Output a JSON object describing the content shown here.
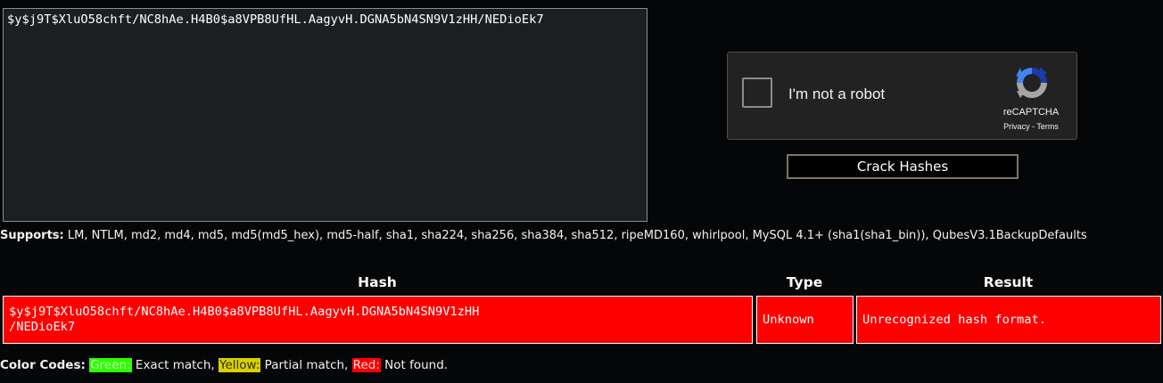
{
  "hash_input": {
    "value": "$y$j9T$XluO58chft/NC8hAe.H4B0$a8VPB8UfHL.AagyvH.DGNA5bN4SN9V1zHH/NEDioEk7"
  },
  "recaptcha": {
    "checkbox_label": "I'm not a robot",
    "brand": "reCAPTCHA",
    "privacy_label": "Privacy",
    "separator": " - ",
    "terms_label": "Terms",
    "checked": false,
    "logo_icon": "recaptcha-logo-icon"
  },
  "crack_button": {
    "label": "Crack Hashes"
  },
  "supports": {
    "label": "Supports:",
    "list": " LM, NTLM, md2, md4, md5, md5(md5_hex), md5-half, sha1, sha224, sha256, sha384, sha512, ripeMD160, whirlpool, MySQL 4.1+ (sha1(sha1_bin)), QubesV3.1BackupDefaults"
  },
  "results": {
    "columns": [
      "Hash",
      "Type",
      "Result"
    ],
    "rows": [
      {
        "hash_line1": "$y$j9T$XluO58chft/NC8hAe.H4B0$a8VPB8UfHL.AagyvH.DGNA5bN4SN9V1zHH",
        "hash_line2": "/NEDioEk7",
        "type": "Unknown",
        "result": "Unrecognized hash format.",
        "status_color": "#ff0000"
      }
    ]
  },
  "color_codes": {
    "label": "Color Codes:",
    "green_label": "Green:",
    "green_desc": " Exact match, ",
    "yellow_label": "Yellow:",
    "yellow_desc": " Partial match, ",
    "red_label": "Red:",
    "red_desc": " Not found.",
    "green_color": "#2bff00",
    "yellow_color": "#d8d000",
    "red_color": "#ff0000"
  }
}
